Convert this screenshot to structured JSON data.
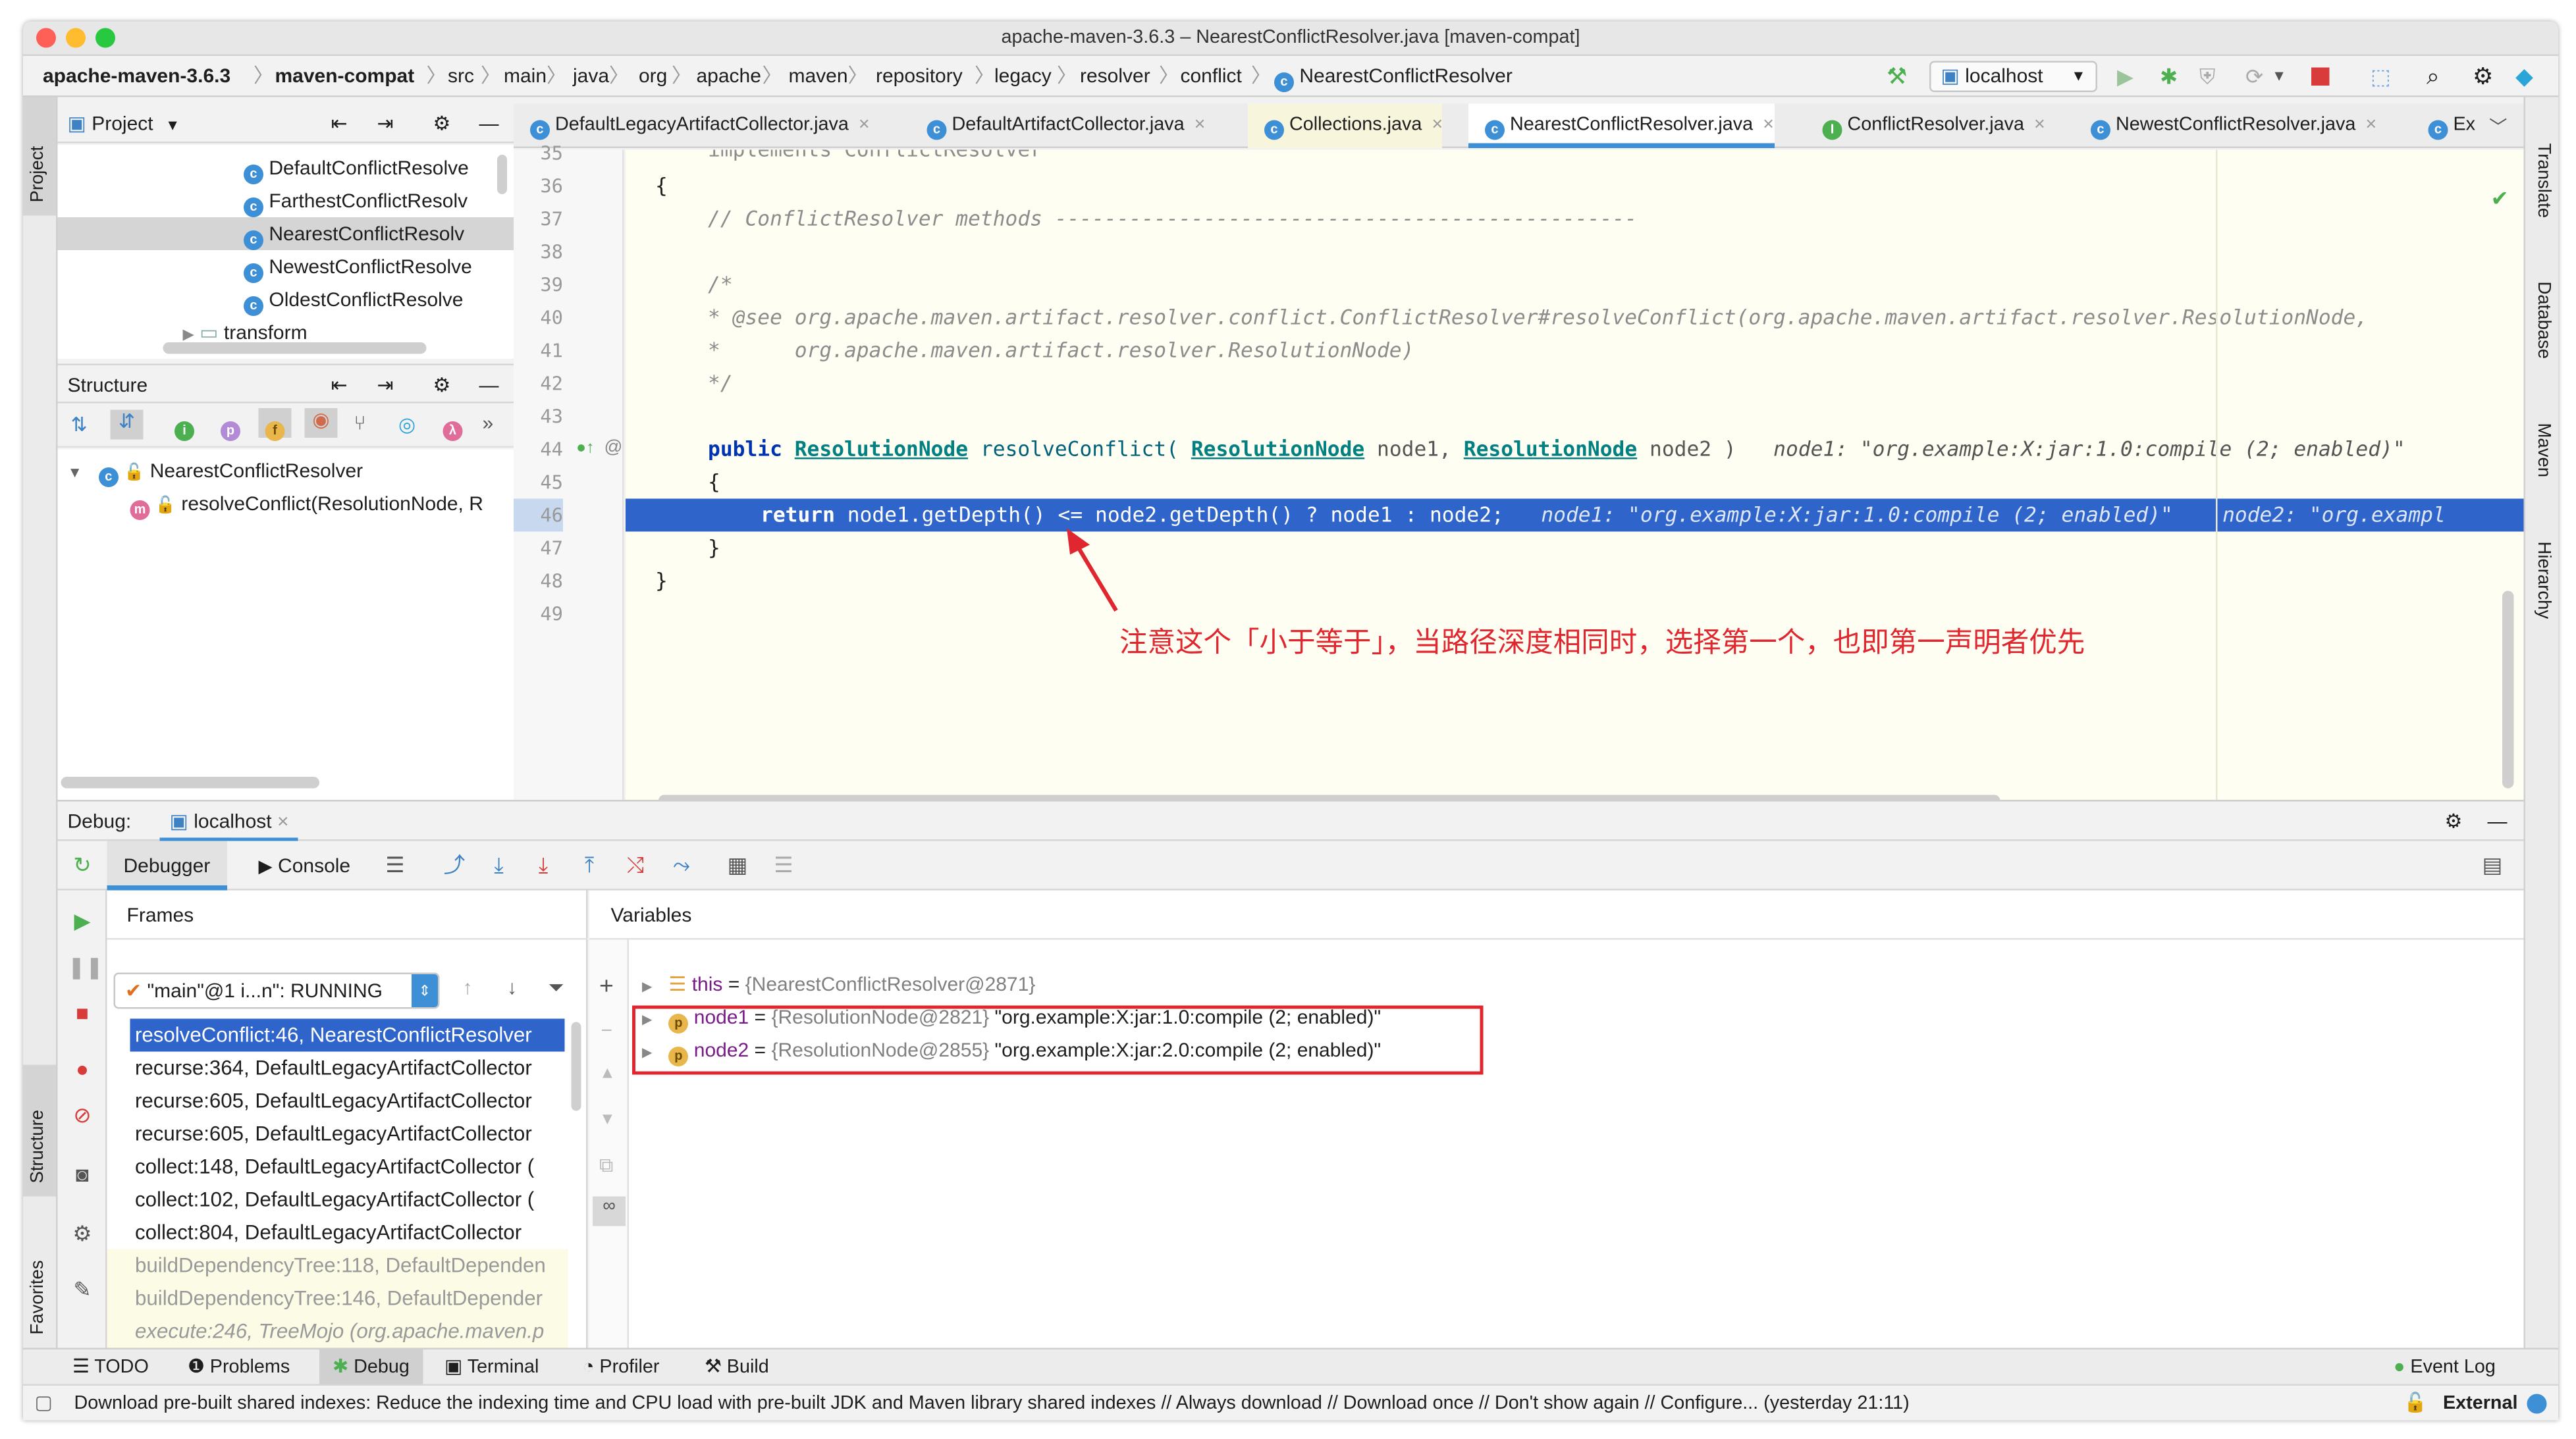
{
  "window": {
    "title": "apache-maven-3.6.3 – NearestConflictResolver.java [maven-compat]"
  },
  "breadcrumbs": [
    "apache-maven-3.6.3",
    "maven-compat",
    "src",
    "main",
    "java",
    "org",
    "apache",
    "maven",
    "repository",
    "legacy",
    "resolver",
    "conflict",
    "NearestConflictResolver"
  ],
  "run_config": "localhost",
  "left_strip": {
    "project": "Project",
    "structure": "Structure",
    "favorites": "Favorites"
  },
  "right_strip": {
    "translate": "Translate",
    "database": "Database",
    "maven": "Maven",
    "hierarchy": "Hierarchy"
  },
  "project_panel": {
    "title": "Project",
    "items": [
      "DefaultConflictResolve",
      "FarthestConflictResolv",
      "NearestConflictResolv",
      "NewestConflictResolve",
      "OldestConflictResolve",
      "transform"
    ]
  },
  "structure_panel": {
    "title": "Structure",
    "class_name": "NearestConflictResolver",
    "method": "resolveConflict(ResolutionNode, R"
  },
  "tabs": [
    {
      "label": "DefaultLegacyArtifactCollector.java",
      "icon": "C"
    },
    {
      "label": "DefaultArtifactCollector.java",
      "icon": "C"
    },
    {
      "label": "Collections.java",
      "icon": "C"
    },
    {
      "label": "NearestConflictResolver.java",
      "icon": "C"
    },
    {
      "label": "ConflictResolver.java",
      "icon": "I"
    },
    {
      "label": "NewestConflictResolver.java",
      "icon": "C"
    },
    {
      "label": "Ex",
      "icon": "C"
    }
  ],
  "code": {
    "line_numbers": [
      "36",
      "37",
      "38",
      "39",
      "40",
      "41",
      "42",
      "43",
      "44",
      "45",
      "46",
      "47",
      "48",
      "49"
    ],
    "partial_top": "implements ConflictResolver",
    "l36": "{",
    "l37": "// ConflictResolver methods -----------------------------------------------",
    "l39": "/*",
    "l40": "* @see org.apache.maven.artifact.resolver.conflict.ConflictResolver#resolveConflict(org.apache.maven.artifact.resolver.ResolutionNode,",
    "l41": "*      org.apache.maven.artifact.resolver.ResolutionNode)",
    "l42": "*/",
    "l44_kw": "public",
    "l44_type": "ResolutionNode",
    "l44_fn": "resolveConflict(",
    "l44_p1": "node1,",
    "l44_p2": "node2 )",
    "l44_hint": "node1: \"org.example:X:jar:1.0:compile (2; enabled)\"",
    "l45": "{",
    "l46_kw": "return",
    "l46_code": "node1.getDepth() <= node2.getDepth() ? node1 : node2;",
    "l46_hint1": "node1: \"org.example:X:jar:1.0:compile (2; enabled)\"",
    "l46_hint2": "node2: \"org.exampl",
    "l47": "}",
    "l48": "}",
    "annotation": "注意这个「小于等于」，当路径深度相同时，选择第一个，也即第一声明者优先"
  },
  "debug": {
    "label": "Debug:",
    "session": "localhost",
    "tab_debugger": "Debugger",
    "tab_console": "Console",
    "frames_title": "Frames",
    "thread": "\"main\"@1 i...n\": RUNNING",
    "frames": [
      "resolveConflict:46, NearestConflictResolver",
      "recurse:364, DefaultLegacyArtifactCollector",
      "recurse:605, DefaultLegacyArtifactCollector",
      "recurse:605, DefaultLegacyArtifactCollector",
      "collect:148, DefaultLegacyArtifactCollector (",
      "collect:102, DefaultLegacyArtifactCollector (",
      "collect:804, DefaultLegacyArtifactCollector",
      "buildDependencyTree:118, DefaultDependen",
      "buildDependencyTree:146, DefaultDepender",
      "execute:246, TreeMojo (org.apache.maven.p"
    ],
    "variables_title": "Variables",
    "vars": [
      {
        "name": "this",
        "ref": "{NearestConflictResolver@2871}",
        "value": ""
      },
      {
        "name": "node1",
        "ref": "{ResolutionNode@2821}",
        "value": "\"org.example:X:jar:1.0:compile (2; enabled)\""
      },
      {
        "name": "node2",
        "ref": "{ResolutionNode@2855}",
        "value": "\"org.example:X:jar:2.0:compile (2; enabled)\""
      }
    ]
  },
  "bottom_tabs": [
    "TODO",
    "Problems",
    "Debug",
    "Terminal",
    "Profiler",
    "Build"
  ],
  "event_log": "Event Log",
  "status": {
    "message": "Download pre-built shared indexes: Reduce the indexing time and CPU load with pre-built JDK and Maven library shared indexes // Always download // Download once // Don't show again // Configure... (yesterday 21:11)",
    "right": "External"
  },
  "colors": {
    "accent": "#2f65ca",
    "highlight_box": "#e0262e",
    "annotation": "#e0262e"
  }
}
